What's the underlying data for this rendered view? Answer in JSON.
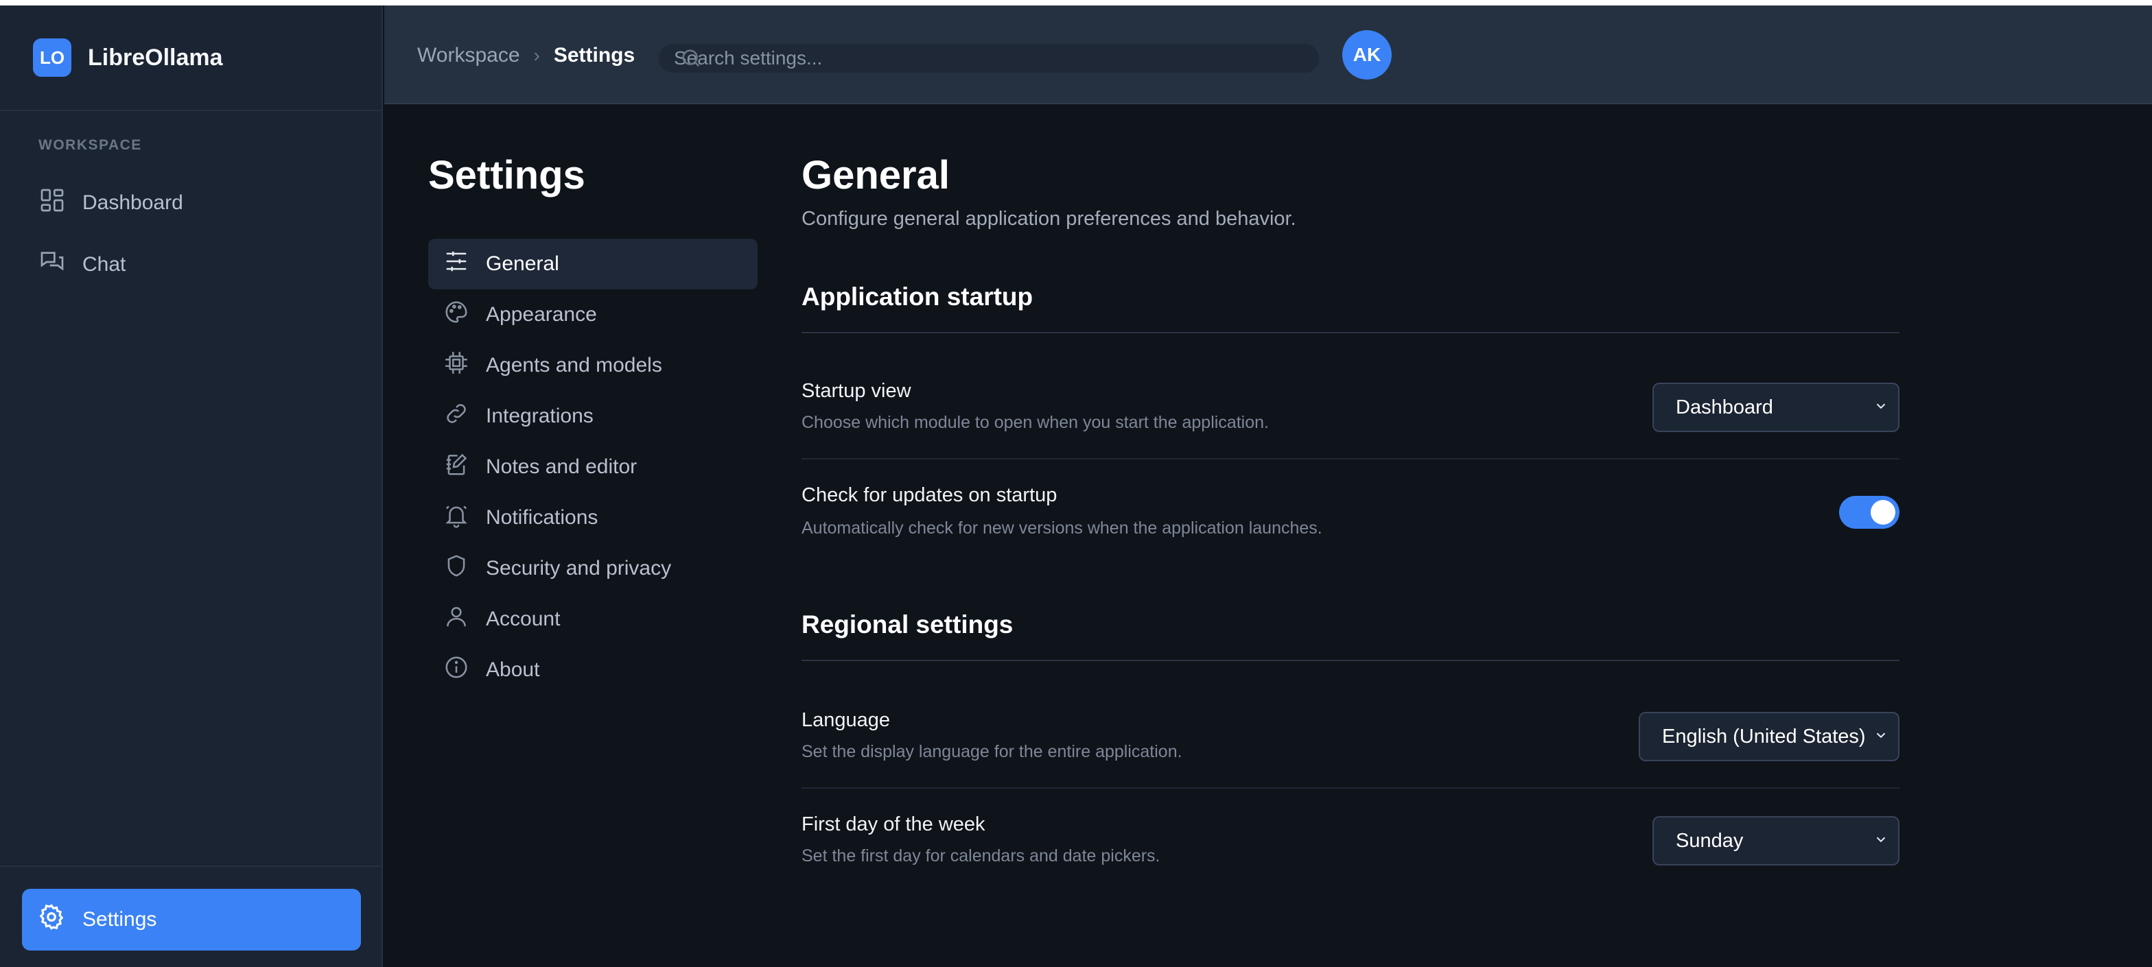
{
  "brand": {
    "logo": "LO",
    "name": "LibreOllama"
  },
  "sidebar": {
    "section_label": "WORKSPACE",
    "items": [
      {
        "label": "Dashboard",
        "icon": "grid-icon"
      },
      {
        "label": "Chat",
        "icon": "chat-icon"
      }
    ],
    "settings_button": {
      "label": "Settings",
      "icon": "gear-icon"
    }
  },
  "header": {
    "breadcrumb": [
      "Workspace",
      "Settings"
    ],
    "search_placeholder": "Search settings...",
    "avatar": "AK"
  },
  "settings_nav": {
    "title": "Settings",
    "items": [
      {
        "label": "General",
        "icon": "sliders-icon",
        "active": true
      },
      {
        "label": "Appearance",
        "icon": "palette-icon"
      },
      {
        "label": "Agents and models",
        "icon": "cpu-icon"
      },
      {
        "label": "Integrations",
        "icon": "link-icon"
      },
      {
        "label": "Notes and editor",
        "icon": "notebook-icon"
      },
      {
        "label": "Notifications",
        "icon": "bell-icon"
      },
      {
        "label": "Security and privacy",
        "icon": "shield-icon"
      },
      {
        "label": "Account",
        "icon": "user-icon"
      },
      {
        "label": "About",
        "icon": "info-icon"
      }
    ]
  },
  "content": {
    "title": "General",
    "subtitle": "Configure general application preferences and behavior.",
    "sections": [
      {
        "title": "Application startup",
        "rows": [
          {
            "title": "Startup view",
            "description": "Choose which module to open when you start the application.",
            "control": "select",
            "value": "Dashboard"
          },
          {
            "title": "Check for updates on startup",
            "description": "Automatically check for new versions when the application launches.",
            "control": "toggle",
            "value": true
          }
        ]
      },
      {
        "title": "Regional settings",
        "rows": [
          {
            "title": "Language",
            "description": "Set the display language for the entire application.",
            "control": "select",
            "value": "English (United States)"
          },
          {
            "title": "First day of the week",
            "description": "Set the first day for calendars and date pickers.",
            "control": "select",
            "value": "Sunday"
          }
        ]
      }
    ]
  },
  "colors": {
    "accent": "#3b82f6",
    "sidebar_bg": "#1b2432",
    "page_bg": "#0f131a"
  }
}
